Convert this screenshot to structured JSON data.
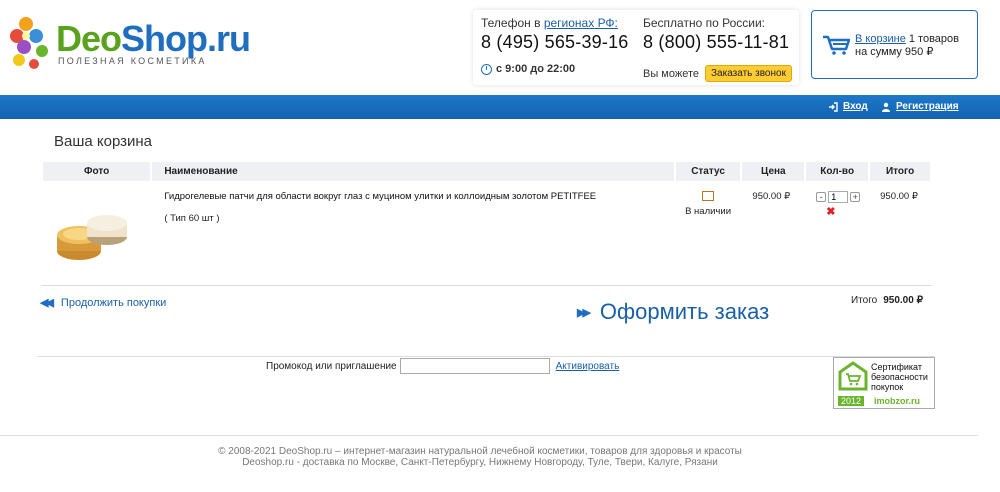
{
  "header": {
    "logo_deo": "Deo",
    "logo_shop": "Shop.ru",
    "logo_subtitle": "ПОЛЕЗНАЯ КОСМЕТИКА",
    "phone_label_prefix": "Телефон в ",
    "phone_label_link": "регионах РФ:",
    "phone_number": "8 (495) 565-39-16",
    "hours": "с 9:00 до 22:00",
    "free_label": "Бесплатно по России:",
    "free_number": "8 (800) 555-11-81",
    "can_text": "Вы можете",
    "call_button": "Заказать звонок",
    "cart_link": "В корзине",
    "cart_count": " 1 товаров",
    "cart_sum": "на сумму 950 ₽"
  },
  "topbar": {
    "login": "Вход",
    "register": "Регистрация"
  },
  "page_title": "Ваша корзина",
  "table": {
    "headers": {
      "photo": "Фото",
      "name": "Наименование",
      "status": "Статус",
      "price": "Цена",
      "qty": "Кол-во",
      "total": "Итого"
    },
    "rows": [
      {
        "name": "Гидрогелевые патчи для области вокруг глаз с муцином улитки и коллоидным золотом PETITFEE",
        "type": "( Тип 60 шт )",
        "status": "В наличии",
        "price": "950.00 ₽",
        "qty": "1",
        "total": "950.00 ₽"
      }
    ]
  },
  "continue_label": "Продолжить покупки",
  "total_label": "Итого",
  "total_value": "950.00 ₽",
  "checkout_label": "Оформить заказ",
  "promo": {
    "label": "Промокод или приглашение",
    "value": "",
    "activate": "Активировать"
  },
  "cert": {
    "line1": "Сертификат",
    "line2": "безопасности",
    "line3": "покупок",
    "year": "2012",
    "site": "imobzor.ru"
  },
  "footer": {
    "line1": "© 2008-2021 DeoShop.ru – интернет-магазин натуральной лечебной косметики, товаров для здоровья и красоты",
    "line2": "Deoshop.ru - доставка по Москве, Санкт-Петербургу, Нижнему Новгороду, Туле, Твери, Калуге, Рязани"
  },
  "colors": {
    "brand_blue": "#1f6fc0",
    "brand_green": "#58a21d",
    "accent_yellow": "#ffcc33"
  }
}
